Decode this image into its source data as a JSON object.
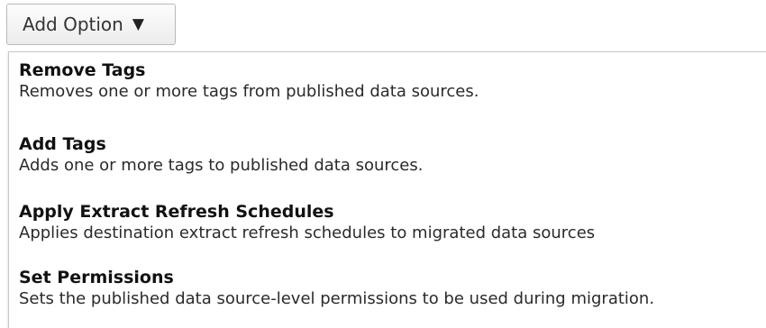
{
  "button": {
    "label": "Add Option",
    "caret": "▼"
  },
  "menu": {
    "items": [
      {
        "title": "Remove Tags",
        "description": "Removes one or more tags from published data sources."
      },
      {
        "title": "Add Tags",
        "description": "Adds one or more tags to published data sources."
      },
      {
        "title": "Apply Extract Refresh Schedules",
        "description": "Applies destination extract refresh schedules to migrated data sources"
      },
      {
        "title": "Set Permissions",
        "description": "Sets the published data source-level permissions to be used during migration."
      }
    ]
  }
}
